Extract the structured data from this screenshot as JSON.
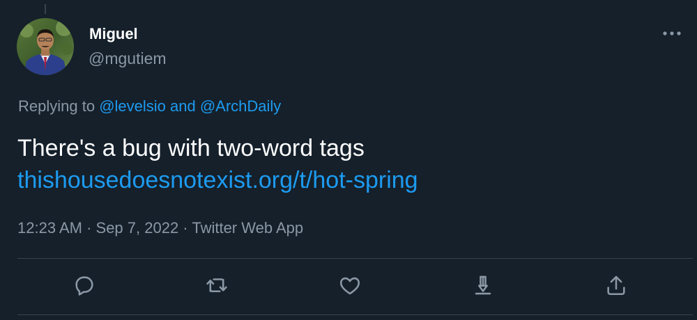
{
  "author": {
    "name": "Miguel",
    "handle": "@mgutiem"
  },
  "reply": {
    "prefix": "Replying to ",
    "mention1": "@levelsio",
    "conjunction": " and ",
    "mention2": "@ArchDaily"
  },
  "tweet": {
    "text": "There's a bug with two-word tags",
    "link": "thishousedoesnotexist.org/t/hot-spring"
  },
  "meta": {
    "time": "12:23 AM",
    "separator1": " · ",
    "date": "Sep 7, 2022",
    "separator2": " · ",
    "source": "Twitter Web App"
  },
  "actions": [
    {
      "icon": "reply-icon"
    },
    {
      "icon": "retweet-icon"
    },
    {
      "icon": "like-icon"
    },
    {
      "icon": "download-icon"
    },
    {
      "icon": "share-icon"
    }
  ],
  "colors": {
    "background": "#15202b",
    "accent": "#1d9bf0",
    "secondary_text": "#8b98a5",
    "primary_text": "#ffffff",
    "divider": "#38444d"
  }
}
